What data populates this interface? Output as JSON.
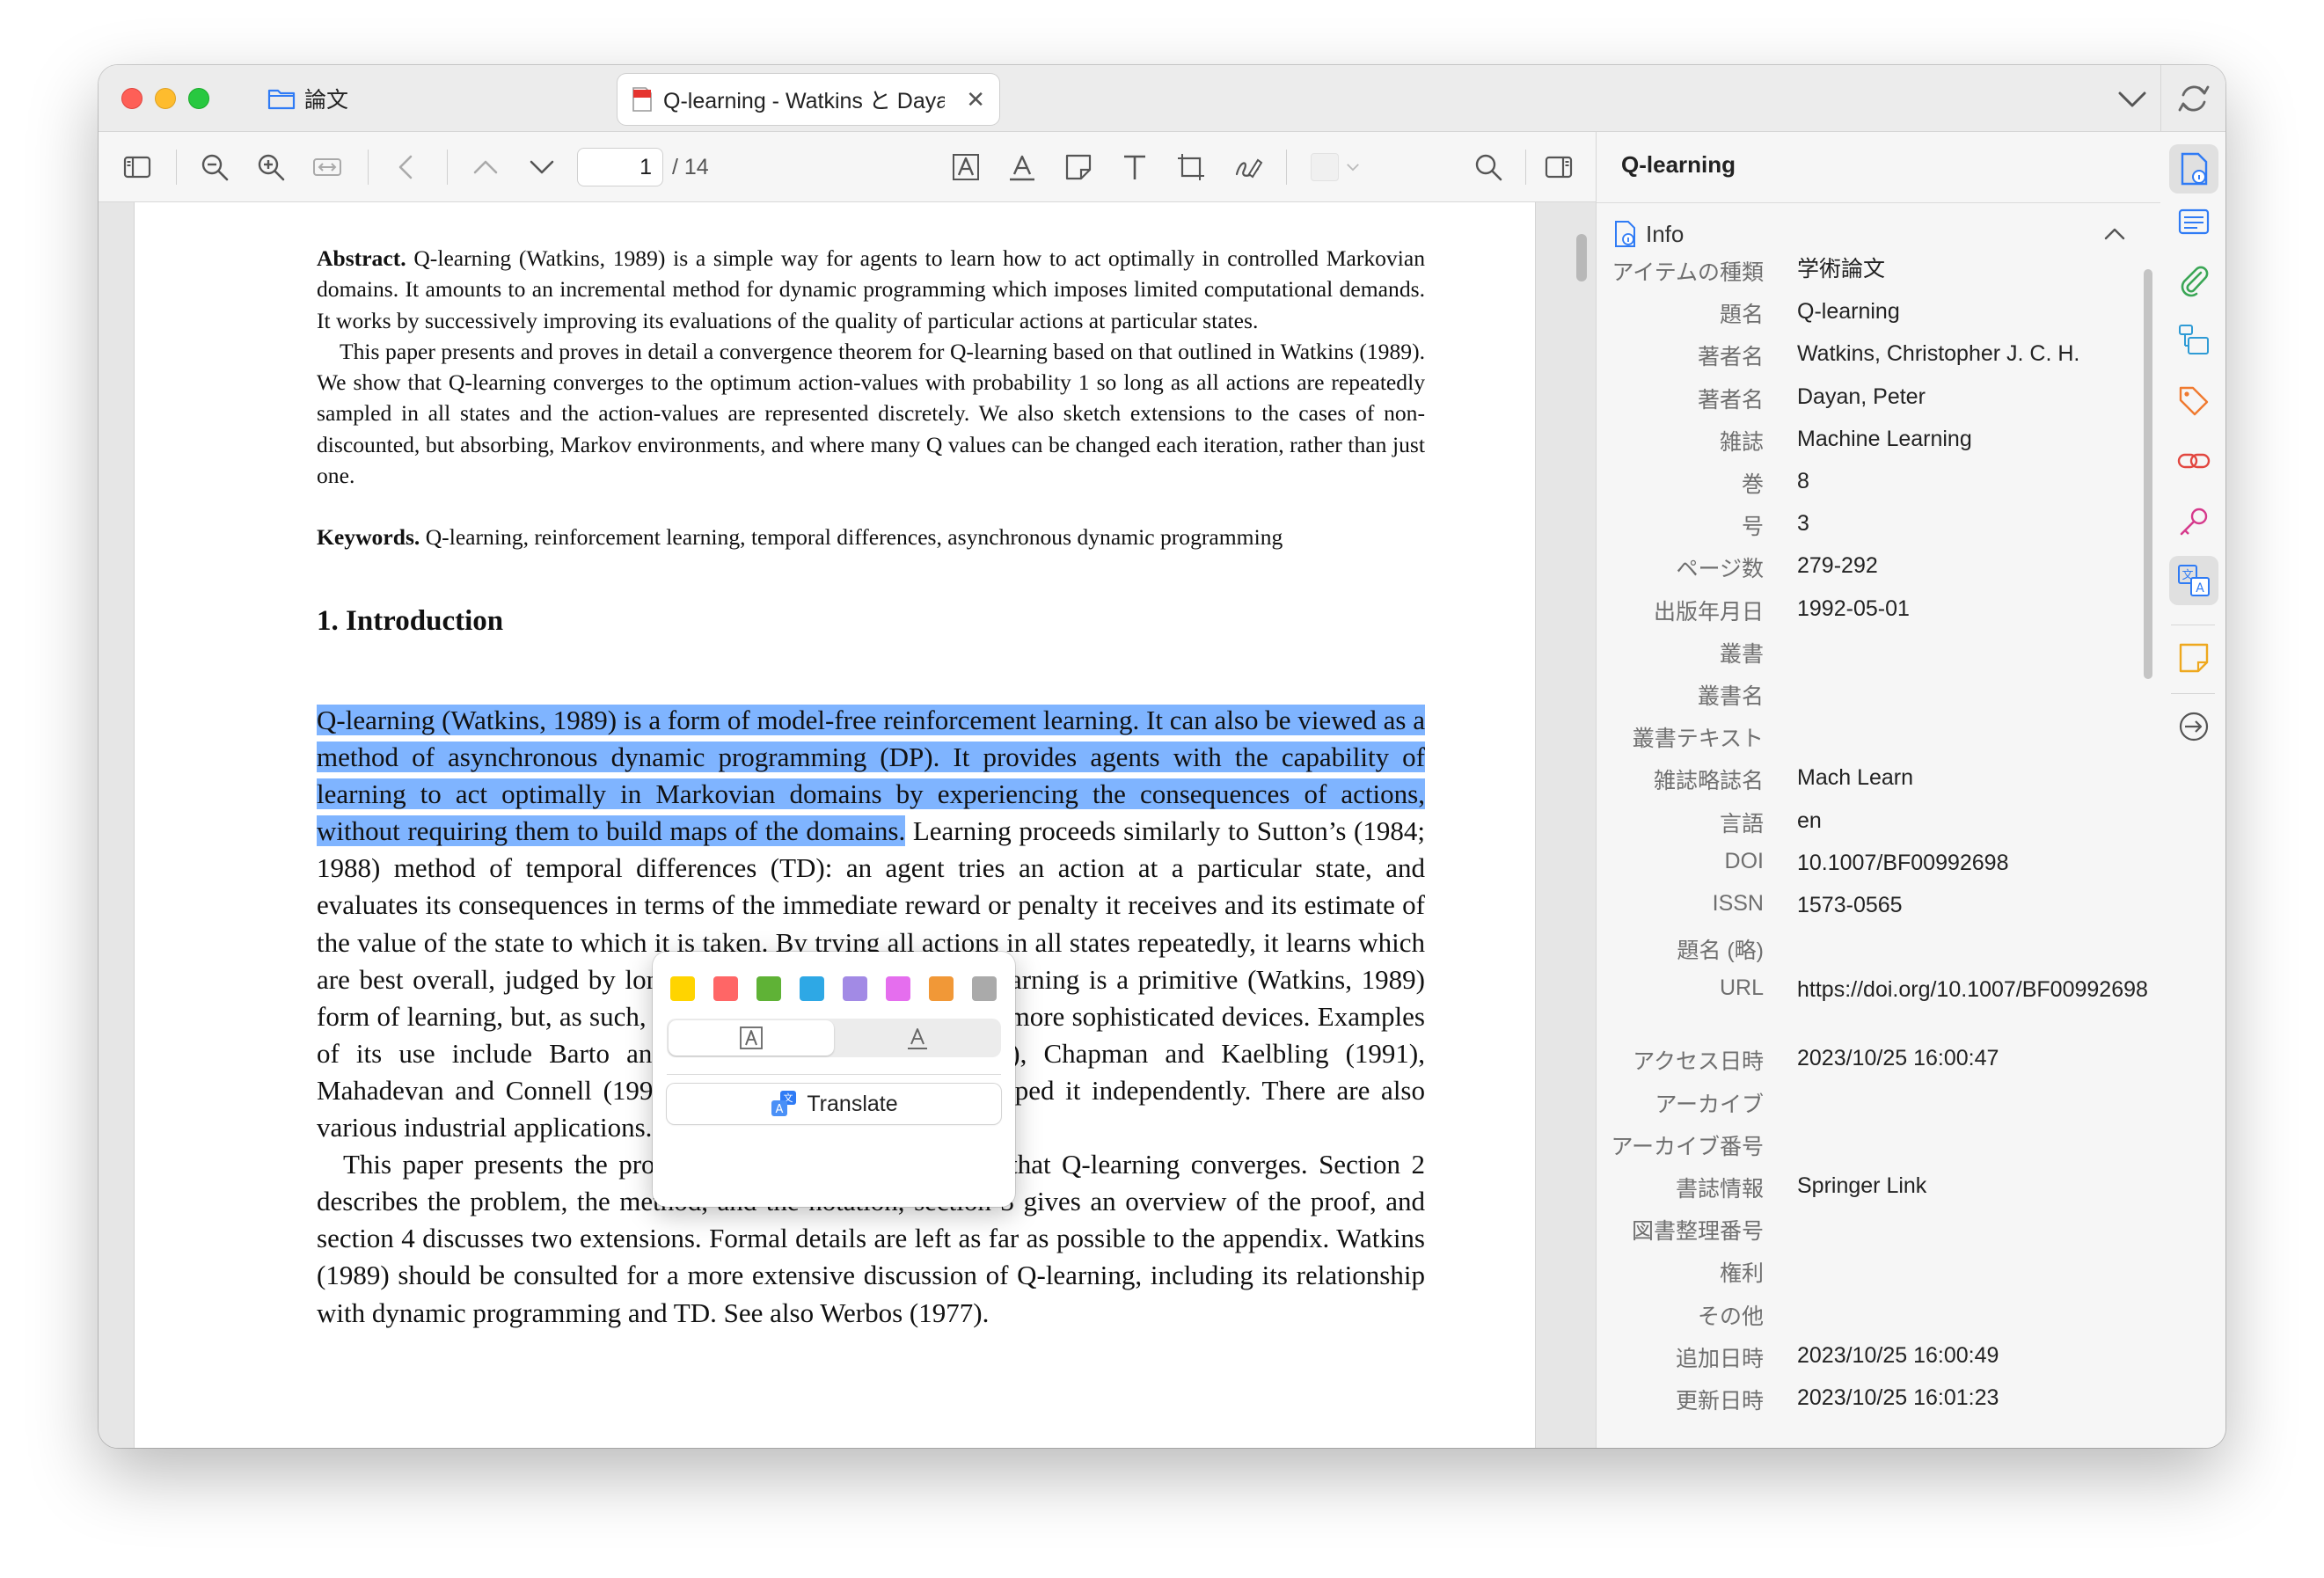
{
  "titlebar": {
    "library_tab": "論文",
    "doc_tab": "Q-learning - Watkins と Dayan"
  },
  "toolbar": {
    "page_current": "1",
    "page_total": "/ 14"
  },
  "paper": {
    "abstract_label": "Abstract.",
    "abstract_p1": "Q-learning (Watkins, 1989) is a simple way for agents to learn how to act optimally in controlled Markovian domains. It amounts to an incremental method for dynamic programming which imposes limited computational demands. It works by successively improving its evaluations of the quality of particular actions at particular states.",
    "abstract_p2": "This paper presents and proves in detail a convergence theorem for Q-learning based on that outlined in Watkins (1989). We show that Q-learning converges to the optimum action-values with probability 1 so long as all actions are repeatedly sampled in all states and the action-values are represented discretely. We also sketch extensions to the cases of non-discounted, but absorbing, Markov environments, and where many Q values can be changed each iteration, rather than just one.",
    "keywords_label": "Keywords.",
    "keywords": "Q-learning, reinforcement learning, temporal differences, asynchronous dynamic programming",
    "section_heading": "1.  Introduction",
    "highlighted": "Q-learning (Watkins, 1989) is a form of model-free reinforcement learning. It can also be viewed as a method of asynchronous dynamic programming (DP). It provides agents with the capability of learning to act optimally in Markovian domains by experiencing the consequences of actions, without requiring them to build maps of the domains.",
    "para1_rest": "Learning proceeds similarly to Sutton’s (1984; 1988) method of temporal differences (TD): an agent tries an action at a particular state, and evaluates its consequences in terms of the immediate reward or penalty it receives and its estimate of the value of the state to which it is taken. By trying all actions in all states repeatedly, it learns which are best overall, judged by long-term discounted reward. Q-learning is a primitive (Watkins, 1989) form of learning, but, as such, it can operate as the basis of far more sophisticated devices. Examples of its use include Barto and Singh (1990), Sutton (1990), Chapman and Kaelbling (1991), Mahadevan and Connell (1991), and Lin (1992), who developed it independently. There are also various industrial applications.",
    "para2": "This paper presents the proof outlined by Watkins (1989) that Q-learning converges. Section 2 describes the problem, the method, and the notation, section 3 gives an overview of the proof, and section 4 discusses two extensions. Formal details are left as far as possible to the appendix. Watkins (1989) should be consulted for a more extensive discussion of Q-learning, including its relationship with dynamic programming and TD. See also Werbos (1977)."
  },
  "popup": {
    "colors": [
      "#ffd400",
      "#ff6666",
      "#5fb236",
      "#2ea8e5",
      "#a28ae5",
      "#e56eee",
      "#f19837",
      "#aaaaaa"
    ],
    "translate_label": "Translate"
  },
  "info": {
    "pane_title": "Q-learning",
    "section_label": "Info",
    "fields": [
      {
        "label": "アイテムの種類",
        "value": "学術論文"
      },
      {
        "label": "題名",
        "value": "Q-learning"
      },
      {
        "label": "著者名",
        "value": "Watkins, Christopher J. C. H."
      },
      {
        "label": "著者名",
        "value": "Dayan, Peter"
      },
      {
        "label": "雑誌",
        "value": "Machine Learning"
      },
      {
        "label": "巻",
        "value": "8"
      },
      {
        "label": "号",
        "value": "3"
      },
      {
        "label": "ページ数",
        "value": "279-292"
      },
      {
        "label": "出版年月日",
        "value": "1992-05-01"
      },
      {
        "label": "叢書",
        "value": ""
      },
      {
        "label": "叢書名",
        "value": ""
      },
      {
        "label": "叢書テキスト",
        "value": ""
      },
      {
        "label": "雑誌略誌名",
        "value": "Mach Learn"
      },
      {
        "label": "言語",
        "value": "en"
      },
      {
        "label": "DOI",
        "value": "10.1007/BF00992698"
      },
      {
        "label": "ISSN",
        "value": "1573-0565"
      },
      {
        "label": "題名 (略)",
        "value": ""
      },
      {
        "label": "URL",
        "value": "https://doi.org/10.1007/BF00992698"
      },
      {
        "label": "アクセス日時",
        "value": "2023/10/25 16:00:47"
      },
      {
        "label": "アーカイブ",
        "value": ""
      },
      {
        "label": "アーカイブ番号",
        "value": ""
      },
      {
        "label": "書誌情報",
        "value": "Springer Link"
      },
      {
        "label": "図書整理番号",
        "value": ""
      },
      {
        "label": "権利",
        "value": ""
      },
      {
        "label": "その他",
        "value": ""
      },
      {
        "label": "追加日時",
        "value": "2023/10/25 16:00:49"
      },
      {
        "label": "更新日時",
        "value": "2023/10/25 16:01:23"
      }
    ]
  },
  "side_icons": [
    "info-doc-icon",
    "abstract-icon",
    "attachment-icon",
    "libraries-icon",
    "tag-icon",
    "related-icon",
    "key-icon",
    "translate-icon",
    "note-icon",
    "locate-icon"
  ]
}
